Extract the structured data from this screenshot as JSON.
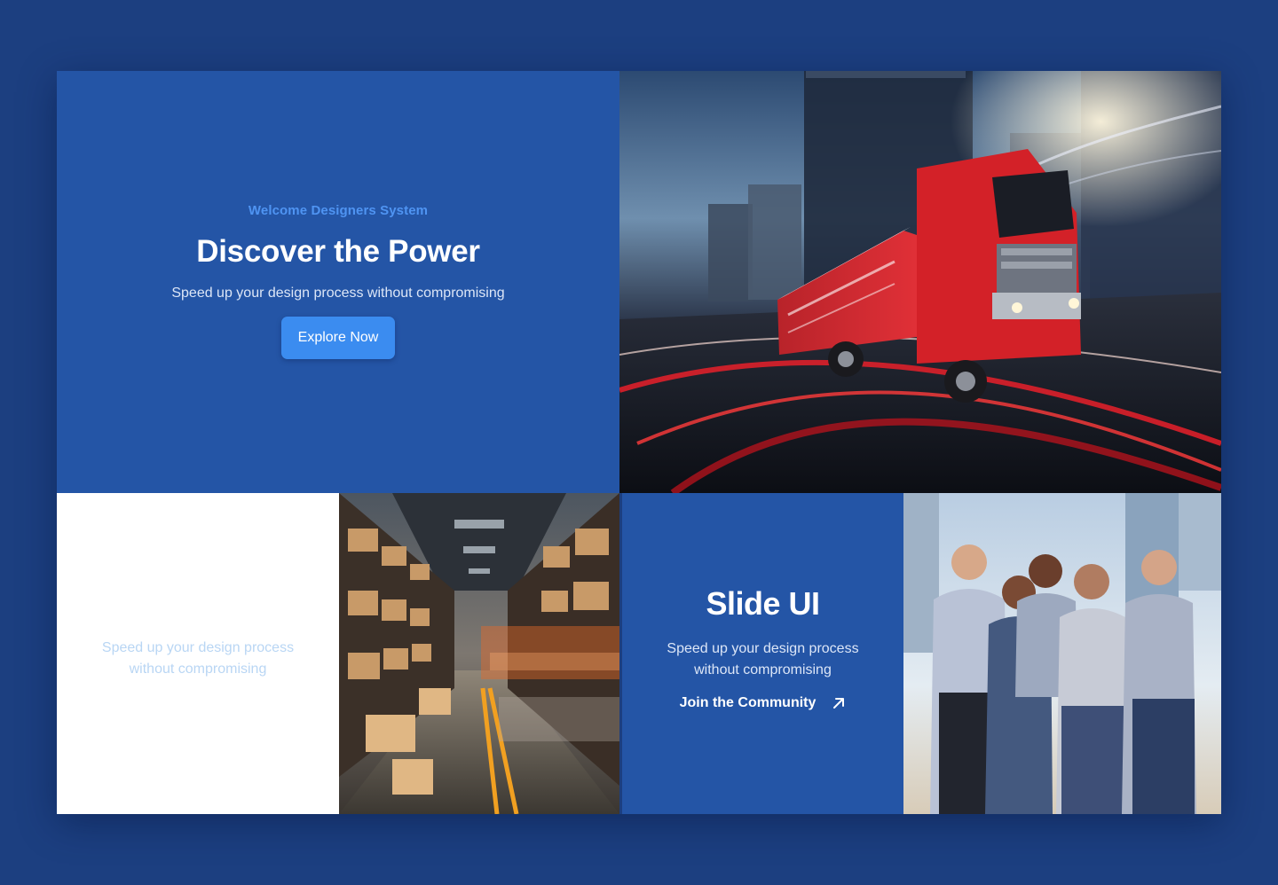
{
  "hero": {
    "eyebrow": "Welcome Designers System",
    "title": "Discover the Power",
    "subtitle": "Speed up your design process without compromising",
    "cta_label": "Explore Now"
  },
  "tile": {
    "text_line1": "Speed up your design process",
    "text_line2": "without compromising"
  },
  "slide": {
    "title": "Slide UI",
    "subtitle_line1": "Speed up your design process",
    "subtitle_line2": "without compromising",
    "link_label": "Join the Community",
    "link_icon": "arrow-up-right-icon"
  },
  "colors": {
    "page_background": "#1c3f80",
    "panel_blue": "#2455a6",
    "accent_blue": "#3b8cf0",
    "eyebrow_blue": "#4f94f2",
    "truck_red": "#d32128"
  },
  "images": {
    "hero_photo": "red-truck-in-motion",
    "warehouse_photo": "warehouse-aisle-with-boxes",
    "team_photo": "team-of-workers-in-uniform"
  }
}
